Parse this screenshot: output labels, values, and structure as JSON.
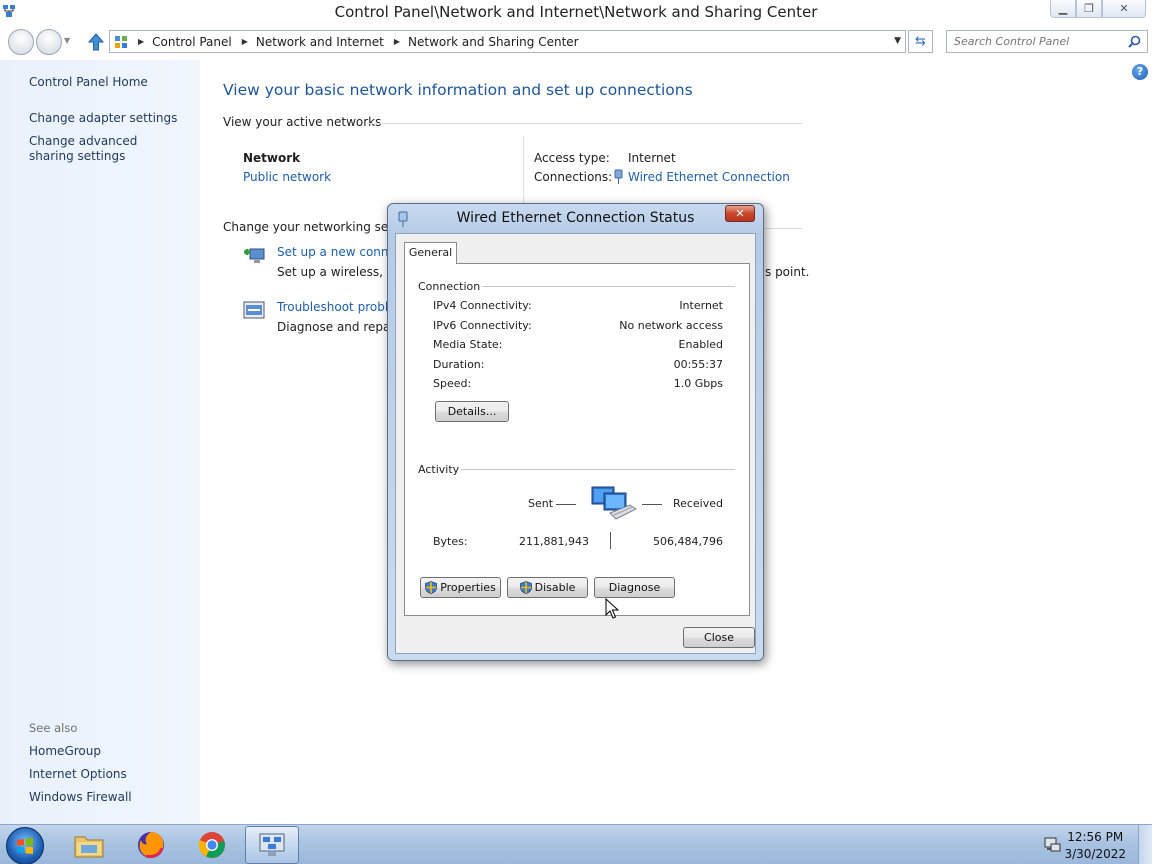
{
  "window": {
    "title": "Control Panel\\Network and Internet\\Network and Sharing Center",
    "minimize_icon": "minimize-icon",
    "maximize_icon": "maximize-icon",
    "close_icon": "close-icon"
  },
  "address_bar": {
    "breadcrumbs": [
      "Control Panel",
      "Network and Internet",
      "Network and Sharing Center"
    ],
    "search_placeholder": "Search Control Panel"
  },
  "sidebar": {
    "home": "Control Panel Home",
    "items": [
      "Change adapter settings",
      "Change advanced sharing settings"
    ],
    "see_also_label": "See also",
    "see_also": [
      "HomeGroup",
      "Internet Options",
      "Windows Firewall"
    ]
  },
  "main": {
    "heading": "View your basic network information and set up connections",
    "active_networks_label": "View your active networks",
    "network_name": "Network",
    "network_type": "Public network",
    "access_type_label": "Access type:",
    "access_type_value": "Internet",
    "connections_label": "Connections:",
    "connections_value": "Wired Ethernet Connection",
    "change_settings_label": "Change your networking settin",
    "tasks": [
      {
        "title": "Set up a new connec",
        "desc": "Set up a wireless, bro",
        "desc_tail": "s point."
      },
      {
        "title": "Troubleshoot probler",
        "desc": "Diagnose and repair n"
      }
    ]
  },
  "dialog": {
    "title": "Wired Ethernet Connection Status",
    "tab": "General",
    "connection_group": "Connection",
    "rows": [
      {
        "label": "IPv4 Connectivity:",
        "value": "Internet"
      },
      {
        "label": "IPv6 Connectivity:",
        "value": "No network access"
      },
      {
        "label": "Media State:",
        "value": "Enabled"
      },
      {
        "label": "Duration:",
        "value": "00:55:37"
      },
      {
        "label": "Speed:",
        "value": "1.0 Gbps"
      }
    ],
    "details_button": "Details...",
    "activity_group": "Activity",
    "sent_label": "Sent",
    "received_label": "Received",
    "bytes_label": "Bytes:",
    "bytes_sent": "211,881,943",
    "bytes_received": "506,484,796",
    "properties_button": "Properties",
    "disable_button": "Disable",
    "diagnose_button": "Diagnose",
    "close_button": "Close"
  },
  "taskbar": {
    "time": "12:56 PM",
    "date": "3/30/2022",
    "apps": [
      "windows-explorer-icon",
      "firefox-icon",
      "chrome-icon",
      "control-panel-icon"
    ]
  }
}
